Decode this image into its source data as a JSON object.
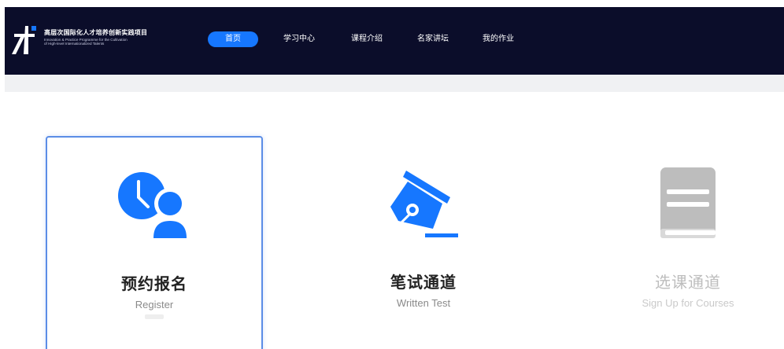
{
  "brand": {
    "title": "高层次国际化人才培养创新实践项目",
    "subtitle_line1": "Innovation & Practice Programme for the Cultivation",
    "subtitle_line2": "of High-level Internationalized Talents"
  },
  "nav": {
    "items": [
      {
        "label": "首页",
        "active": true
      },
      {
        "label": "学习中心",
        "active": false
      },
      {
        "label": "课程介绍",
        "active": false
      },
      {
        "label": "名家讲坛",
        "active": false
      },
      {
        "label": "我的作业",
        "active": false
      }
    ]
  },
  "cards": [
    {
      "icon": "clock-user-icon",
      "title": "预约报名",
      "subtitle": "Register",
      "state": "selected"
    },
    {
      "icon": "fountain-pen-icon",
      "title": "笔试通道",
      "subtitle": "Written Test",
      "state": "normal"
    },
    {
      "icon": "book-icon",
      "title": "选课通道",
      "subtitle": "Sign Up for Courses",
      "state": "disabled"
    }
  ],
  "colors": {
    "header_bg": "#0b0d2a",
    "accent": "#1677ff",
    "selected_border": "#5b8de6",
    "disabled_icon": "#bdbdbd"
  }
}
